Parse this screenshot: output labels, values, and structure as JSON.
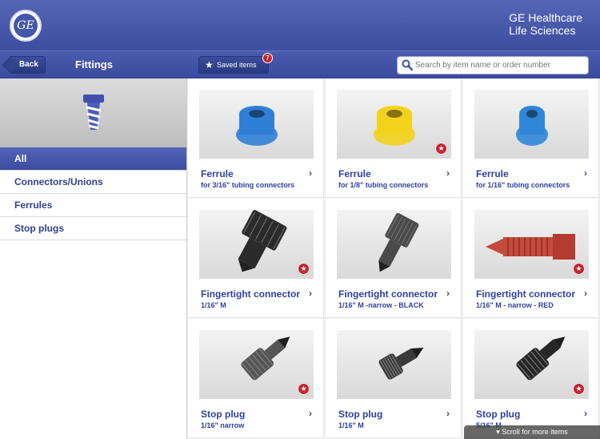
{
  "header": {
    "logo_text": "GE",
    "brand_line1": "GE Healthcare",
    "brand_line2": "Life Sciences"
  },
  "toolbar": {
    "back_label": "Back",
    "title": "Fittings",
    "saved_label": "Saved items",
    "saved_count": "7",
    "search_placeholder": "Search by item name or order number"
  },
  "sidebar": {
    "categories": [
      {
        "label": "All",
        "active": true
      },
      {
        "label": "Connectors/Unions",
        "active": false
      },
      {
        "label": "Ferrules",
        "active": false
      },
      {
        "label": "Stop plugs",
        "active": false
      }
    ]
  },
  "products": [
    {
      "name": "Ferrule",
      "desc": "for 3/16\" tubing connectors",
      "color": "#2f7fd6",
      "shape": "ferrule",
      "saved": false
    },
    {
      "name": "Ferrule",
      "desc": "for 1/8\"  tubing connectors",
      "color": "#f3d21c",
      "shape": "ferrule",
      "saved": true
    },
    {
      "name": "Ferrule",
      "desc": "for 1/16\"  tubing connectors",
      "color": "#2f86d8",
      "shape": "ferrule-narrow",
      "saved": false
    },
    {
      "name": "Fingertight connector",
      "desc": "1/16\" M",
      "color": "#2b2b2b",
      "shape": "connector",
      "saved": true
    },
    {
      "name": "Fingertight connector",
      "desc": "1/16\" M -narrow - BLACK",
      "color": "#4a4a4a",
      "shape": "connector-narrow",
      "saved": false
    },
    {
      "name": "Fingertight connector",
      "desc": "1/16\" M - narrow - RED",
      "color": "#c44a3c",
      "shape": "connector-red",
      "saved": true
    },
    {
      "name": "Stop plug",
      "desc": "1/16\" narrow",
      "color": "#555555",
      "shape": "plug",
      "saved": true
    },
    {
      "name": "Stop plug",
      "desc": "1/16\" M",
      "color": "#3a3a3a",
      "shape": "plug-short",
      "saved": false
    },
    {
      "name": "Stop plug",
      "desc": "5/16\" M",
      "color": "#262626",
      "shape": "plug-dark",
      "saved": true
    }
  ],
  "scroll_hint": "Scroll for more items"
}
